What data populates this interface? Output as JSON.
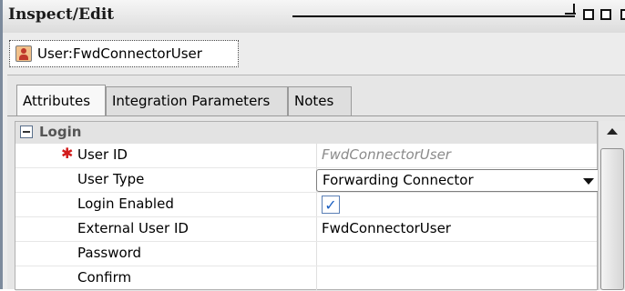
{
  "window": {
    "title": "Inspect/Edit",
    "controls": [
      "minimize-icon",
      "restore-icon",
      "maximize-icon",
      "close-icon"
    ]
  },
  "object_tab": {
    "icon": "user-icon",
    "label": "User:FwdConnectorUser"
  },
  "tabs": [
    {
      "label": "Attributes",
      "active": true
    },
    {
      "label": "Integration Parameters",
      "active": false
    },
    {
      "label": "Notes",
      "active": false
    }
  ],
  "section": {
    "label": "Login",
    "expanded": true
  },
  "fields": {
    "user_id": {
      "label": "User ID",
      "required_marker": "✱",
      "placeholder": "FwdConnectorUser"
    },
    "user_type": {
      "label": "User Type",
      "value": "Forwarding Connector"
    },
    "login_enabled": {
      "label": "Login Enabled",
      "checked": true,
      "check_glyph": "✓"
    },
    "external_user_id": {
      "label": "External User ID",
      "value": "FwdConnectorUser"
    },
    "password": {
      "label": "Password",
      "value": ""
    },
    "confirm": {
      "label": "Confirm",
      "value": ""
    }
  },
  "colors": {
    "required": "#d21c1c",
    "border": "#7c8a9c"
  }
}
